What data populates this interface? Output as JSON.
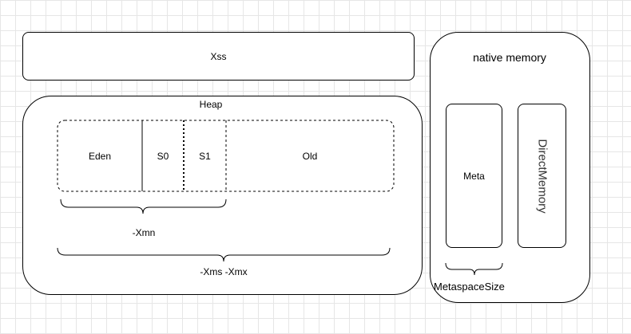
{
  "xss": {
    "label": "Xss"
  },
  "heap": {
    "title": "Heap",
    "regions": [
      "Eden",
      "S0",
      "S1",
      "Old"
    ],
    "xmn_label": "-Xmn",
    "xms_label": "-Xms -Xmx"
  },
  "native": {
    "title": "native memory",
    "meta_label": "Meta",
    "direct_label": "DirectMemory",
    "metaspace_label": "MetaspaceSize"
  }
}
